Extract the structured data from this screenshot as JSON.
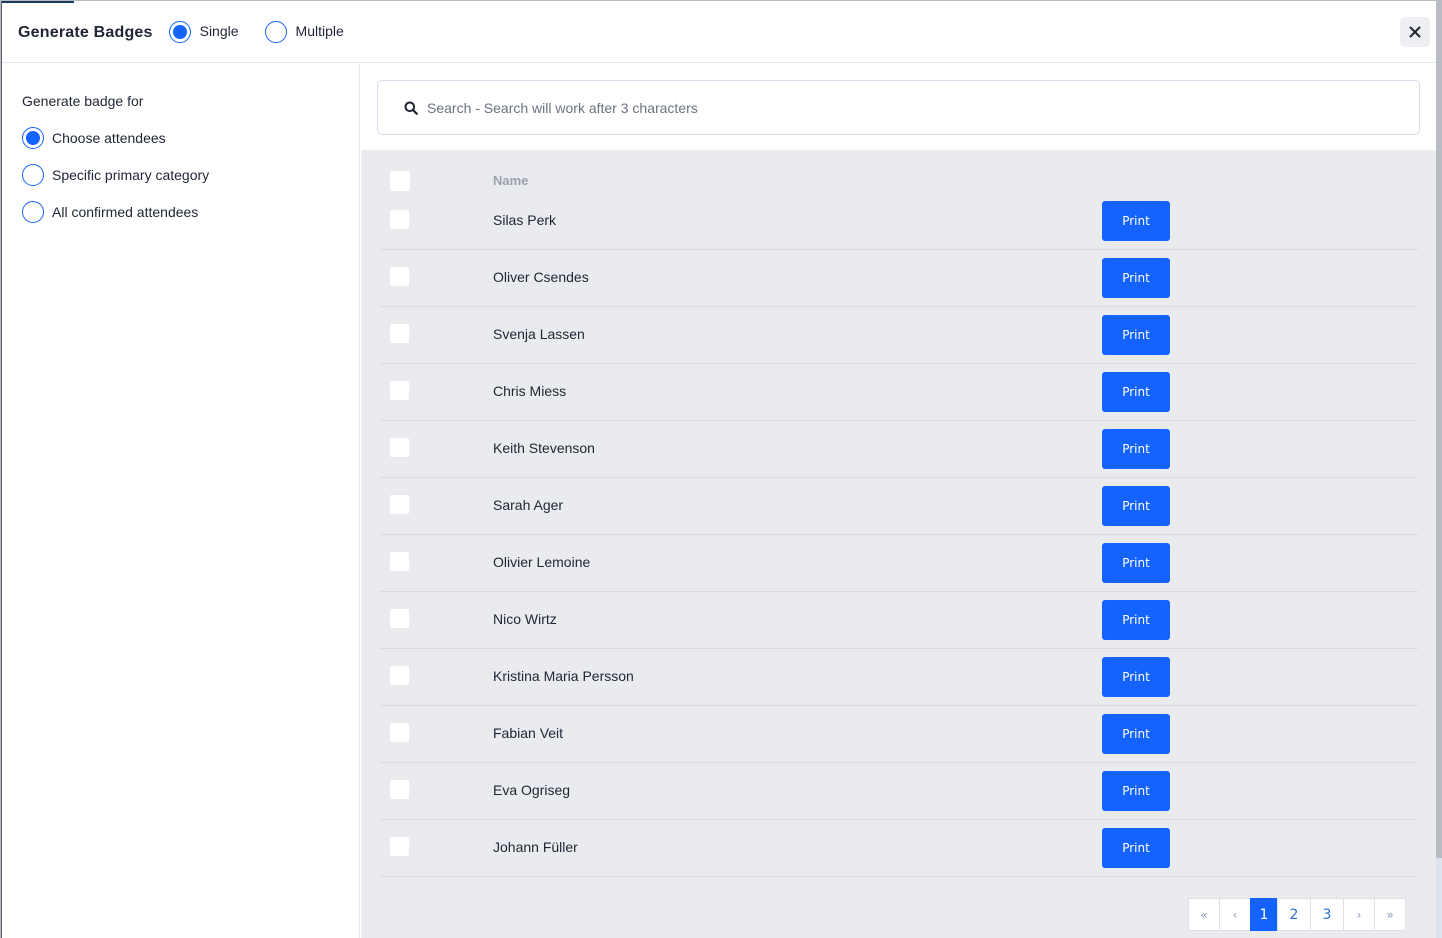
{
  "header": {
    "title": "Generate Badges",
    "mode_options": [
      {
        "label": "Single",
        "checked": true
      },
      {
        "label": "Multiple",
        "checked": false
      }
    ],
    "close_icon": "close-icon"
  },
  "sidebar": {
    "title": "Generate badge for",
    "options": [
      {
        "label": "Choose attendees",
        "checked": true
      },
      {
        "label": "Specific primary category",
        "checked": false
      },
      {
        "label": "All confirmed attendees",
        "checked": false
      }
    ]
  },
  "search": {
    "icon": "search-icon",
    "placeholder": "Search - Search will work after 3 characters",
    "value": ""
  },
  "table": {
    "columns": [
      "Name"
    ],
    "print_label": "Print",
    "rows": [
      {
        "name": "Silas Perk"
      },
      {
        "name": "Oliver Csendes"
      },
      {
        "name": "Svenja Lassen"
      },
      {
        "name": "Chris Miess"
      },
      {
        "name": "Keith Stevenson"
      },
      {
        "name": "Sarah Ager"
      },
      {
        "name": "Olivier Lemoine"
      },
      {
        "name": "Nico Wirtz"
      },
      {
        "name": "Kristina Maria Persson"
      },
      {
        "name": "Fabian Veit"
      },
      {
        "name": "Eva Ogriseg"
      },
      {
        "name": "Johann Füller"
      }
    ]
  },
  "pagination": {
    "first": "«",
    "prev": "‹",
    "pages": [
      "1",
      "2",
      "3"
    ],
    "current": "1",
    "next": "›",
    "last": "»"
  },
  "colors": {
    "accent": "#1463ff",
    "table_bg": "#eaebef"
  }
}
